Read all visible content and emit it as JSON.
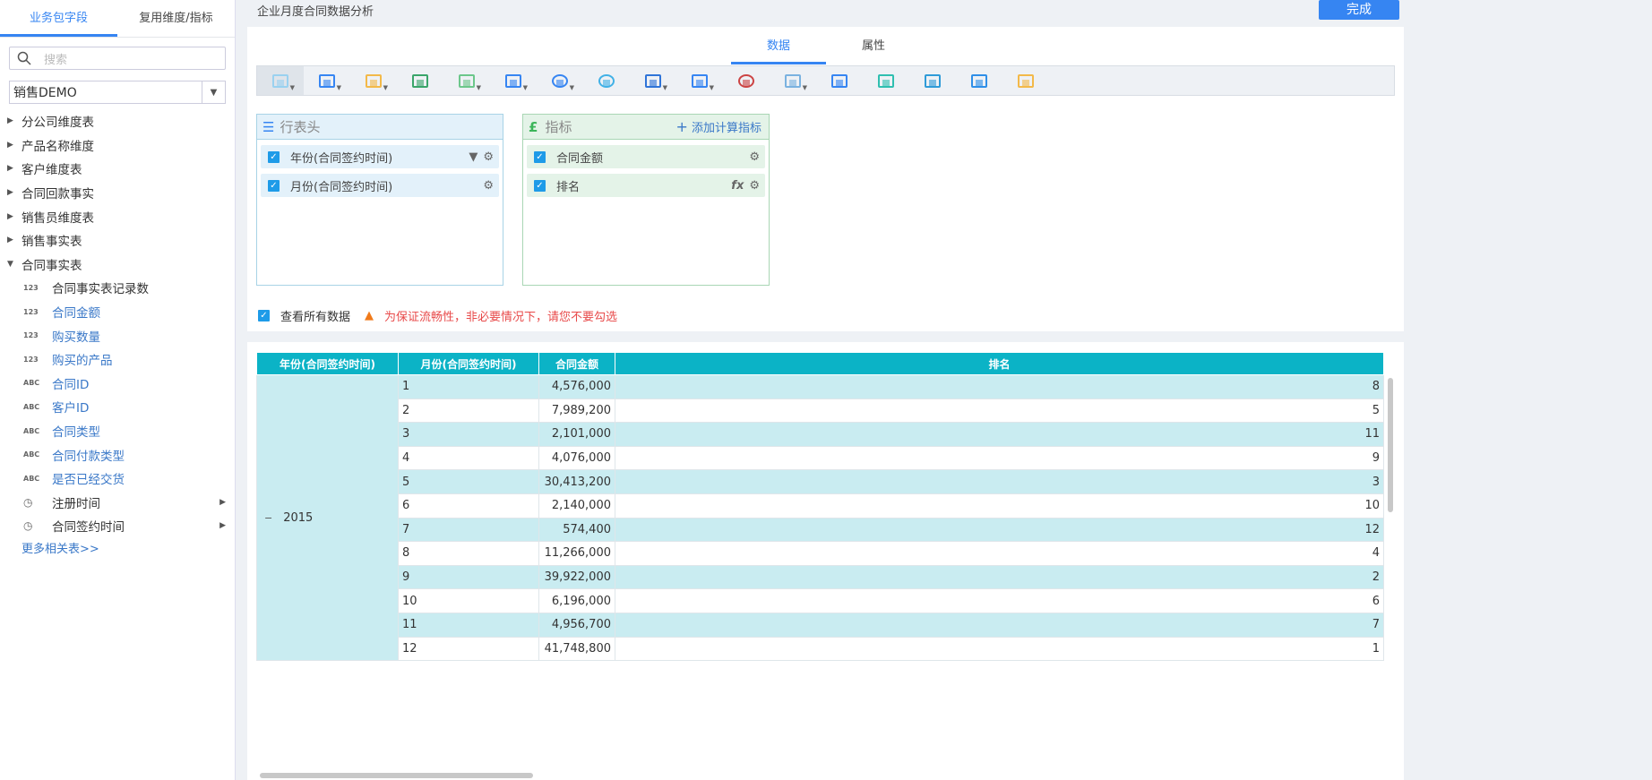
{
  "sidebar": {
    "tabs": [
      "业务包字段",
      "复用维度/指标"
    ],
    "search_placeholder": "搜索",
    "package": "销售DEMO",
    "tables": [
      "分公司维度表",
      "产品名称维度",
      "客户维度表",
      "合同回款事实",
      "销售员维度表",
      "销售事实表",
      "合同事实表"
    ],
    "fields": [
      {
        "type": "123",
        "label": "合同事实表记录数",
        "dark": true
      },
      {
        "type": "123",
        "label": "合同金额"
      },
      {
        "type": "123",
        "label": "购买数量"
      },
      {
        "type": "123",
        "label": "购买的产品"
      },
      {
        "type": "ABC",
        "label": "合同ID"
      },
      {
        "type": "ABC",
        "label": "客户ID"
      },
      {
        "type": "ABC",
        "label": "合同类型"
      },
      {
        "type": "ABC",
        "label": "合同付款类型"
      },
      {
        "type": "ABC",
        "label": "是否已经交货"
      },
      {
        "type": "time",
        "label": "注册时间",
        "dark": true
      },
      {
        "type": "time",
        "label": "合同签约时间",
        "dark": true
      }
    ],
    "more": "更多相关表>>"
  },
  "header": {
    "title": "企业月度合同数据分析",
    "done": "完成"
  },
  "main": {
    "tabs": [
      "数据",
      "属性"
    ],
    "chart_types": [
      "table",
      "bar",
      "horizontal-bar",
      "line",
      "area",
      "combo",
      "pie",
      "donut",
      "china-map",
      "point-map",
      "gauge",
      "radar",
      "scatter",
      "word-cloud",
      "force-bubble",
      "funnel",
      "treemap"
    ],
    "rows_panel": {
      "title": "行表头",
      "items": [
        "年份(合同签约时间)",
        "月份(合同签约时间)"
      ]
    },
    "metrics_panel": {
      "title": "指标",
      "add": "添加计算指标",
      "items": [
        "合同金额",
        "排名"
      ]
    },
    "view_all": "查看所有数据",
    "warning": "为保证流畅性，非必要情况下，请您不要勾选"
  },
  "table": {
    "headers": [
      "年份(合同签约时间)",
      "月份(合同签约时间)",
      "合同金额",
      "排名"
    ],
    "year": "2015",
    "rows": [
      [
        "1",
        "4,576,000",
        "8"
      ],
      [
        "2",
        "7,989,200",
        "5"
      ],
      [
        "3",
        "2,101,000",
        "11"
      ],
      [
        "4",
        "4,076,000",
        "9"
      ],
      [
        "5",
        "30,413,200",
        "3"
      ],
      [
        "6",
        "2,140,000",
        "10"
      ],
      [
        "7",
        "574,400",
        "12"
      ],
      [
        "8",
        "11,266,000",
        "4"
      ],
      [
        "9",
        "39,922,000",
        "2"
      ],
      [
        "10",
        "6,196,000",
        "6"
      ],
      [
        "11",
        "4,956,700",
        "7"
      ],
      [
        "12",
        "41,748,800",
        "1"
      ]
    ]
  }
}
